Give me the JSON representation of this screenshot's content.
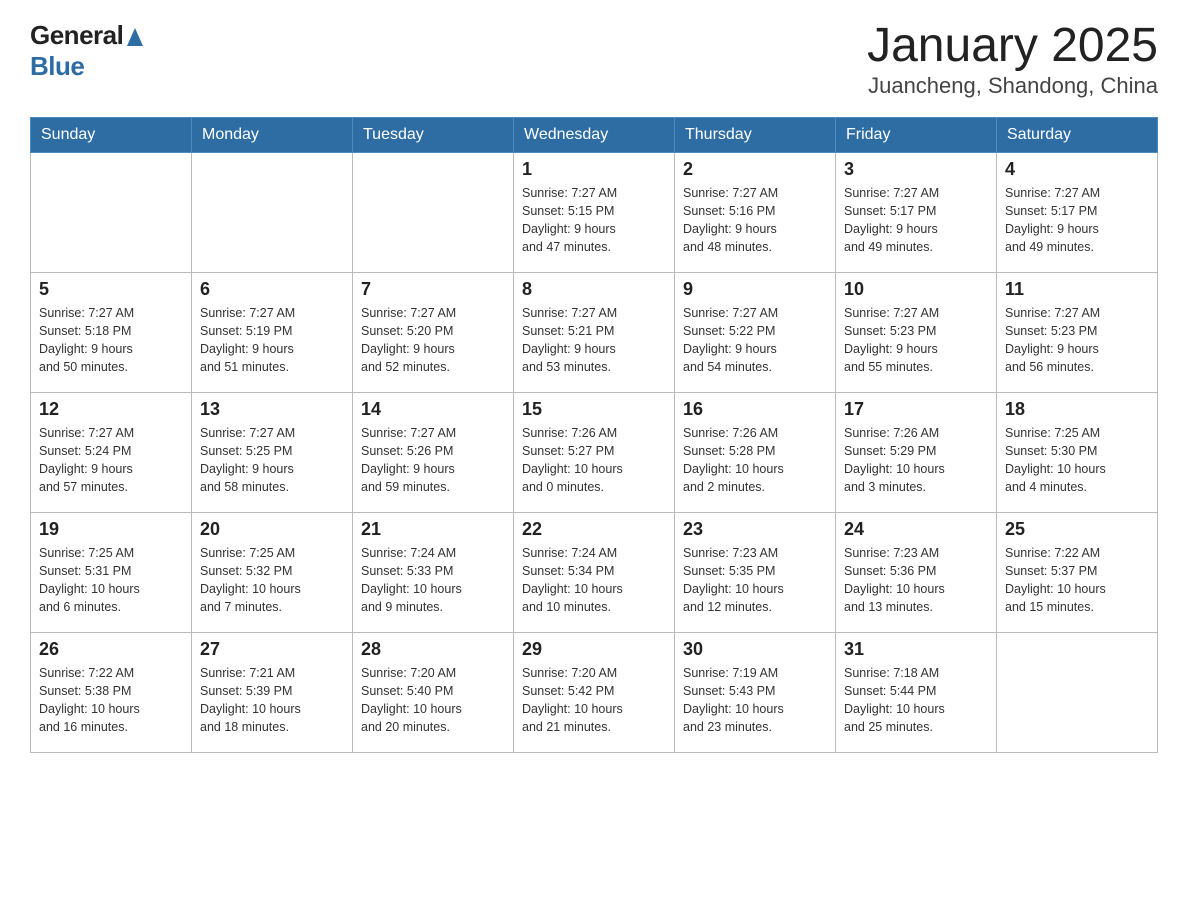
{
  "header": {
    "logo_general": "General",
    "logo_blue": "Blue",
    "title": "January 2025",
    "subtitle": "Juancheng, Shandong, China"
  },
  "days_of_week": [
    "Sunday",
    "Monday",
    "Tuesday",
    "Wednesday",
    "Thursday",
    "Friday",
    "Saturday"
  ],
  "weeks": [
    [
      {
        "day": "",
        "info": ""
      },
      {
        "day": "",
        "info": ""
      },
      {
        "day": "",
        "info": ""
      },
      {
        "day": "1",
        "info": "Sunrise: 7:27 AM\nSunset: 5:15 PM\nDaylight: 9 hours\nand 47 minutes."
      },
      {
        "day": "2",
        "info": "Sunrise: 7:27 AM\nSunset: 5:16 PM\nDaylight: 9 hours\nand 48 minutes."
      },
      {
        "day": "3",
        "info": "Sunrise: 7:27 AM\nSunset: 5:17 PM\nDaylight: 9 hours\nand 49 minutes."
      },
      {
        "day": "4",
        "info": "Sunrise: 7:27 AM\nSunset: 5:17 PM\nDaylight: 9 hours\nand 49 minutes."
      }
    ],
    [
      {
        "day": "5",
        "info": "Sunrise: 7:27 AM\nSunset: 5:18 PM\nDaylight: 9 hours\nand 50 minutes."
      },
      {
        "day": "6",
        "info": "Sunrise: 7:27 AM\nSunset: 5:19 PM\nDaylight: 9 hours\nand 51 minutes."
      },
      {
        "day": "7",
        "info": "Sunrise: 7:27 AM\nSunset: 5:20 PM\nDaylight: 9 hours\nand 52 minutes."
      },
      {
        "day": "8",
        "info": "Sunrise: 7:27 AM\nSunset: 5:21 PM\nDaylight: 9 hours\nand 53 minutes."
      },
      {
        "day": "9",
        "info": "Sunrise: 7:27 AM\nSunset: 5:22 PM\nDaylight: 9 hours\nand 54 minutes."
      },
      {
        "day": "10",
        "info": "Sunrise: 7:27 AM\nSunset: 5:23 PM\nDaylight: 9 hours\nand 55 minutes."
      },
      {
        "day": "11",
        "info": "Sunrise: 7:27 AM\nSunset: 5:23 PM\nDaylight: 9 hours\nand 56 minutes."
      }
    ],
    [
      {
        "day": "12",
        "info": "Sunrise: 7:27 AM\nSunset: 5:24 PM\nDaylight: 9 hours\nand 57 minutes."
      },
      {
        "day": "13",
        "info": "Sunrise: 7:27 AM\nSunset: 5:25 PM\nDaylight: 9 hours\nand 58 minutes."
      },
      {
        "day": "14",
        "info": "Sunrise: 7:27 AM\nSunset: 5:26 PM\nDaylight: 9 hours\nand 59 minutes."
      },
      {
        "day": "15",
        "info": "Sunrise: 7:26 AM\nSunset: 5:27 PM\nDaylight: 10 hours\nand 0 minutes."
      },
      {
        "day": "16",
        "info": "Sunrise: 7:26 AM\nSunset: 5:28 PM\nDaylight: 10 hours\nand 2 minutes."
      },
      {
        "day": "17",
        "info": "Sunrise: 7:26 AM\nSunset: 5:29 PM\nDaylight: 10 hours\nand 3 minutes."
      },
      {
        "day": "18",
        "info": "Sunrise: 7:25 AM\nSunset: 5:30 PM\nDaylight: 10 hours\nand 4 minutes."
      }
    ],
    [
      {
        "day": "19",
        "info": "Sunrise: 7:25 AM\nSunset: 5:31 PM\nDaylight: 10 hours\nand 6 minutes."
      },
      {
        "day": "20",
        "info": "Sunrise: 7:25 AM\nSunset: 5:32 PM\nDaylight: 10 hours\nand 7 minutes."
      },
      {
        "day": "21",
        "info": "Sunrise: 7:24 AM\nSunset: 5:33 PM\nDaylight: 10 hours\nand 9 minutes."
      },
      {
        "day": "22",
        "info": "Sunrise: 7:24 AM\nSunset: 5:34 PM\nDaylight: 10 hours\nand 10 minutes."
      },
      {
        "day": "23",
        "info": "Sunrise: 7:23 AM\nSunset: 5:35 PM\nDaylight: 10 hours\nand 12 minutes."
      },
      {
        "day": "24",
        "info": "Sunrise: 7:23 AM\nSunset: 5:36 PM\nDaylight: 10 hours\nand 13 minutes."
      },
      {
        "day": "25",
        "info": "Sunrise: 7:22 AM\nSunset: 5:37 PM\nDaylight: 10 hours\nand 15 minutes."
      }
    ],
    [
      {
        "day": "26",
        "info": "Sunrise: 7:22 AM\nSunset: 5:38 PM\nDaylight: 10 hours\nand 16 minutes."
      },
      {
        "day": "27",
        "info": "Sunrise: 7:21 AM\nSunset: 5:39 PM\nDaylight: 10 hours\nand 18 minutes."
      },
      {
        "day": "28",
        "info": "Sunrise: 7:20 AM\nSunset: 5:40 PM\nDaylight: 10 hours\nand 20 minutes."
      },
      {
        "day": "29",
        "info": "Sunrise: 7:20 AM\nSunset: 5:42 PM\nDaylight: 10 hours\nand 21 minutes."
      },
      {
        "day": "30",
        "info": "Sunrise: 7:19 AM\nSunset: 5:43 PM\nDaylight: 10 hours\nand 23 minutes."
      },
      {
        "day": "31",
        "info": "Sunrise: 7:18 AM\nSunset: 5:44 PM\nDaylight: 10 hours\nand 25 minutes."
      },
      {
        "day": "",
        "info": ""
      }
    ]
  ]
}
